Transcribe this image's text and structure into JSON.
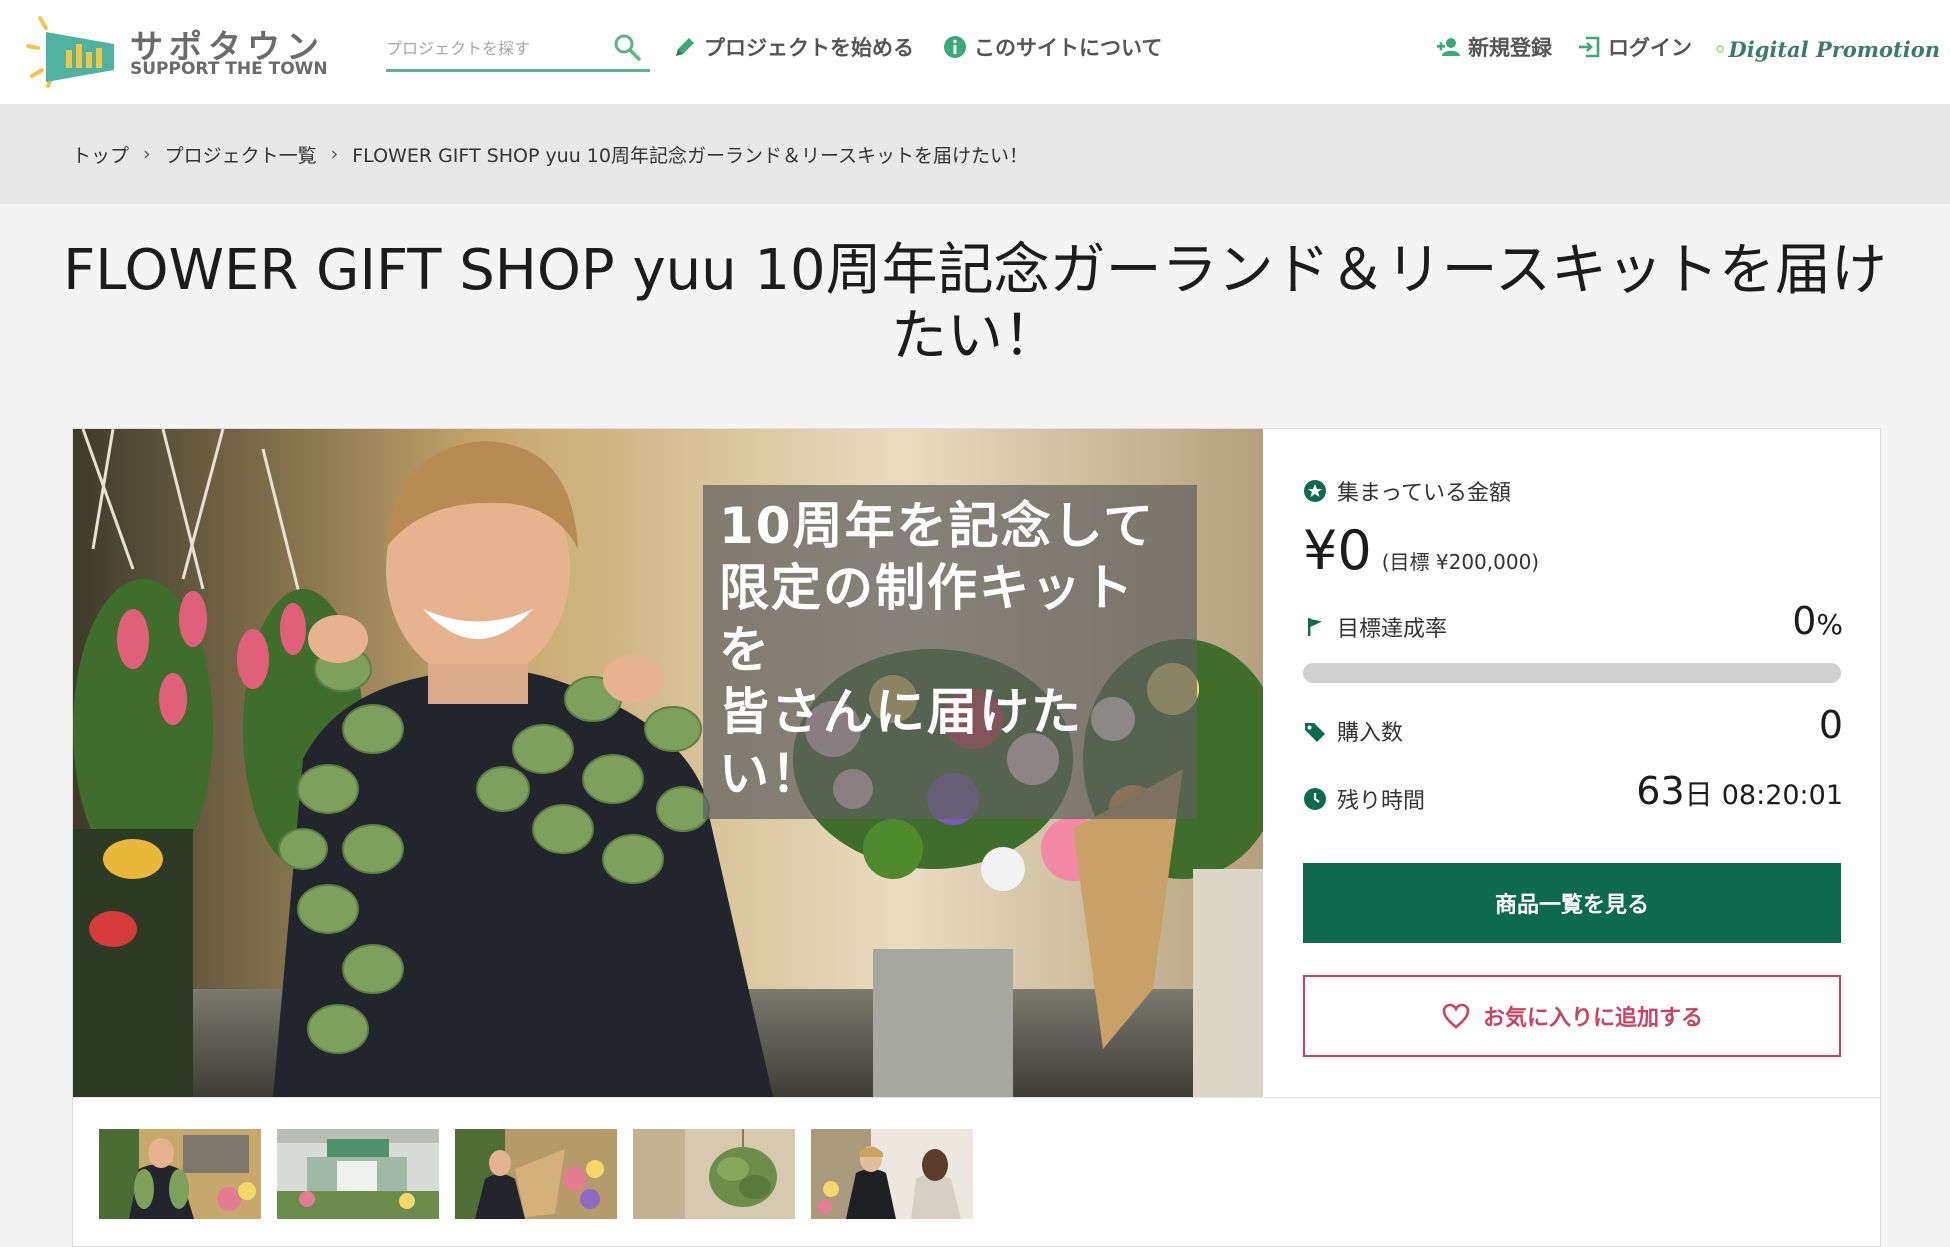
{
  "header": {
    "logo_ja": "サポタウン",
    "logo_en": "SUPPORT THE TOWN",
    "search_placeholder": "プロジェクトを探す",
    "nav": {
      "start_project": "プロジェクトを始める",
      "about": "このサイトについて",
      "register": "新規登録",
      "login": "ログイン"
    },
    "partner": "Digital Promotion"
  },
  "breadcrumb": {
    "items": [
      "トップ",
      "プロジェクト一覧",
      "FLOWER GIFT SHOP yuu 10周年記念ガーランド＆リースキットを届けたい！"
    ],
    "separator": "›"
  },
  "project": {
    "title": "FLOWER GIFT SHOP yuu 10周年記念ガーランド＆リースキットを届けたい！",
    "hero_caption_lines": [
      "10周年を記念して",
      "限定の制作キットを",
      "皆さんに届けたい！"
    ],
    "stats": {
      "raised_label": "集まっている金額",
      "raised_amount": "¥0",
      "goal_text": "(目標 ¥200,000)",
      "achievement_label": "目標達成率",
      "achievement_number": "0",
      "achievement_unit": "%",
      "achievement_fraction": 0,
      "purchases_label": "購入数",
      "purchases_value": "0",
      "remaining_label": "残り時間",
      "remaining_days": "63",
      "remaining_days_unit": "日",
      "remaining_time": "08:20:01"
    },
    "buttons": {
      "view_products": "商品一覧を見る",
      "add_favorite": "お気に入りに追加する"
    }
  },
  "colors": {
    "accent_green": "#0e6a4e",
    "search_underline": "#5cb58c",
    "favorite_pink": "#c94462",
    "logo_teal": "#4fb3a2",
    "logo_yellow": "#f3c744"
  },
  "icons": {
    "search": "search-icon",
    "start": "pencil-icon",
    "about": "info-icon",
    "register": "add-user-icon",
    "login": "login-icon",
    "raised": "star-badge-icon",
    "achievement": "flag-icon",
    "purchases": "tag-icon",
    "remaining": "clock-icon",
    "favorite": "heart-icon"
  }
}
